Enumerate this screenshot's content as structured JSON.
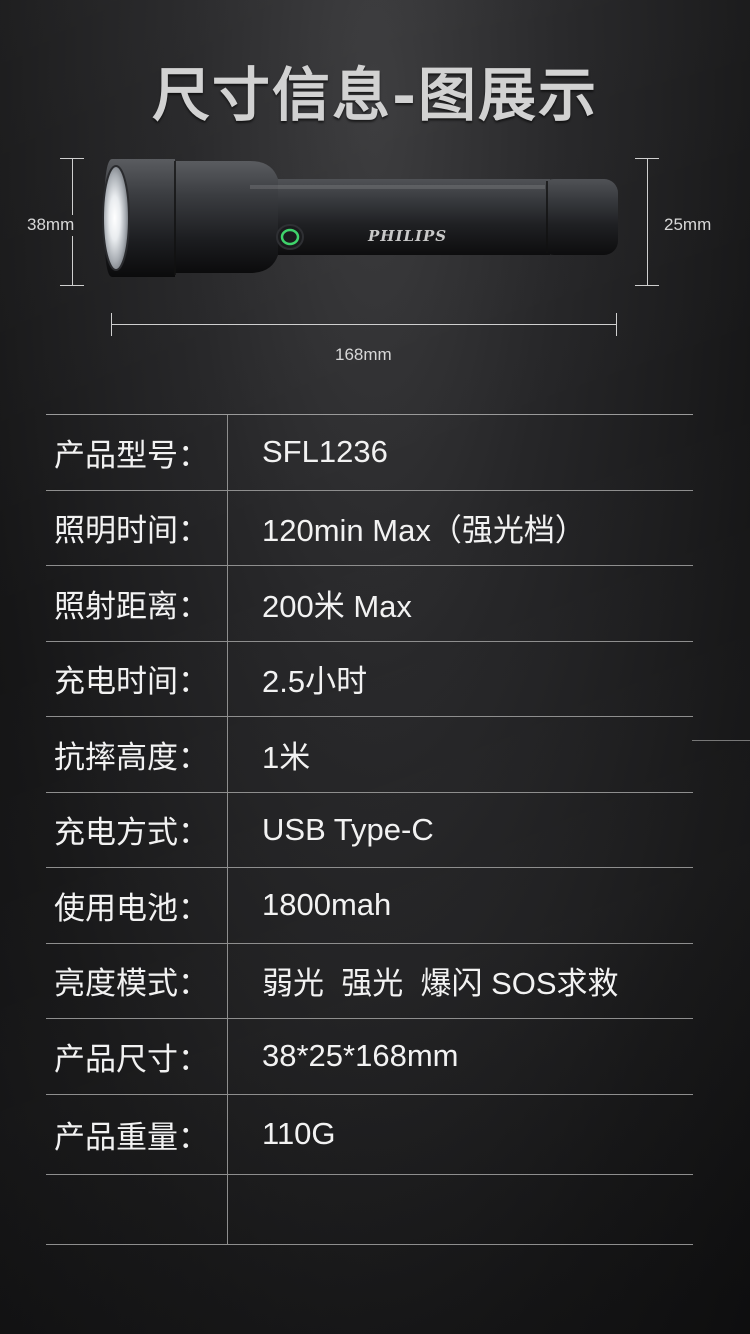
{
  "title": "尺寸信息-图展示",
  "dimensions": {
    "height_left": "38mm",
    "height_right": "25mm",
    "length": "168mm"
  },
  "product": {
    "brand_logo": "PHILIPS",
    "icon": "flashlight-icon"
  },
  "specs": [
    {
      "label": "产品型号：",
      "value": "SFL1236"
    },
    {
      "label": "照明时间：",
      "value": "120min Max（强光档）"
    },
    {
      "label": "照射距离：",
      "value": "200米 Max"
    },
    {
      "label": "充电时间：",
      "value": "2.5小时"
    },
    {
      "label": "抗摔高度：",
      "value": "1米"
    },
    {
      "label": "充电方式：",
      "value": "USB Type-C"
    },
    {
      "label": "使用电池：",
      "value": "1800mah"
    },
    {
      "label": "亮度模式：",
      "value": "弱光  强光  爆闪 SOS求救"
    },
    {
      "label": "产品尺寸：",
      "value": "38*25*168mm"
    },
    {
      "label": "产品重量：",
      "value": "110G"
    }
  ],
  "colors": {
    "background": "#1a1a1b",
    "title": "#d2d2d2",
    "switch_accent": "#3fd36b"
  }
}
